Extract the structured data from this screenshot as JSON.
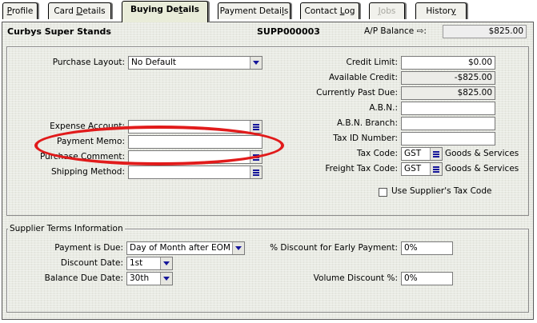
{
  "tabs": [
    {
      "label": "Profile",
      "access": "P",
      "state": "normal"
    },
    {
      "label": "Card Details",
      "access": "D",
      "state": "normal"
    },
    {
      "label": "Buying Details",
      "access": "t",
      "state": "active"
    },
    {
      "label": "Payment Details",
      "access": "l",
      "state": "normal"
    },
    {
      "label": "Contact Log",
      "access": "L",
      "state": "normal"
    },
    {
      "label": "Jobs",
      "access": "J",
      "state": "disabled"
    },
    {
      "label": "History",
      "access": "y",
      "state": "normal"
    }
  ],
  "header": {
    "supplier_name": "Curbys Super Stands",
    "supplier_code": "SUPP000003",
    "balance_label": "A/P Balance ⇨:",
    "balance_value": "$825.00"
  },
  "left_fields": {
    "purchase_layout_label": "Purchase Layout:",
    "purchase_layout_value": "No Default",
    "expense_account_label": "Expense Account:",
    "expense_account_value": "",
    "payment_memo_label": "Payment Memo:",
    "payment_memo_value": "",
    "purchase_comment_label": "Purchase Comment:",
    "purchase_comment_value": "",
    "shipping_method_label": "Shipping Method:",
    "shipping_method_value": ""
  },
  "right_fields": {
    "credit_limit_label": "Credit Limit:",
    "credit_limit_value": "$0.00",
    "available_credit_label": "Available Credit:",
    "available_credit_value": "-$825.00",
    "past_due_label": "Currently Past Due:",
    "past_due_value": "$825.00",
    "abn_label": "A.B.N.:",
    "abn_value": "",
    "abn_branch_label": "A.B.N. Branch:",
    "abn_branch_value": "",
    "tax_id_label": "Tax ID Number:",
    "tax_id_value": "",
    "tax_code_label": "Tax Code:",
    "tax_code_value": "GST",
    "tax_code_desc": "Goods & Services",
    "freight_tax_code_label": "Freight Tax Code:",
    "freight_tax_code_value": "GST",
    "freight_tax_code_desc": "Goods & Services",
    "use_supplier_tax_label": "Use Supplier's Tax Code",
    "use_supplier_tax_checked": false
  },
  "terms": {
    "group_label": "Supplier Terms Information",
    "payment_due_label": "Payment is Due:",
    "payment_due_value": "Day of Month after EOM",
    "discount_date_label": "Discount Date:",
    "discount_date_value": "1st",
    "balance_due_label": "Balance Due Date:",
    "balance_due_value": "30th",
    "early_discount_label": "% Discount for Early Payment:",
    "early_discount_value": "0%",
    "volume_discount_label": "Volume Discount %:",
    "volume_discount_value": "0%"
  },
  "colors": {
    "highlight_ellipse": "#e11b1b",
    "panel_bg": "#e9ebe4",
    "button_glyph": "#16169a"
  }
}
